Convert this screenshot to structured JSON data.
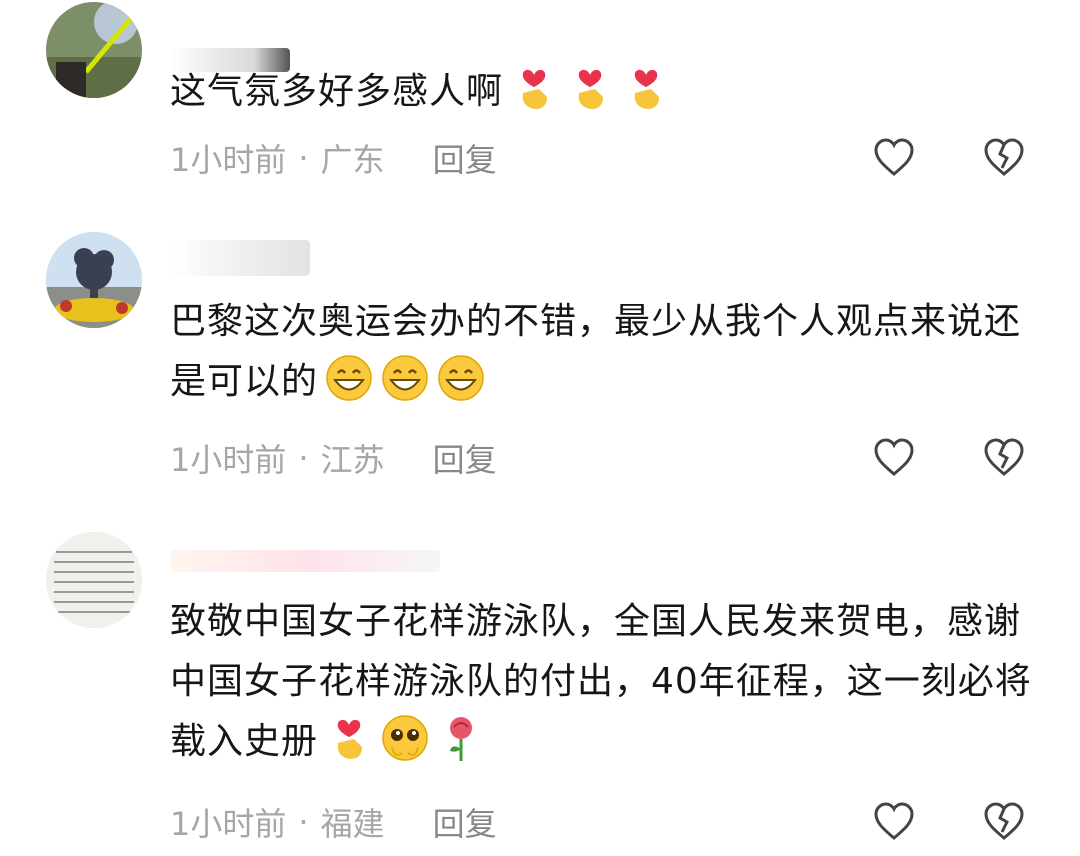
{
  "comments": [
    {
      "text": "这气氛多好多感人啊",
      "emoji": [
        "heart-hand",
        "heart-hand",
        "heart-hand"
      ],
      "time": "1小时前",
      "location": "广东",
      "reply": "回复"
    },
    {
      "text": "巴黎这次奥运会办的不错，最少从我个人观点来说还是可以的",
      "emoji": [
        "grin",
        "grin",
        "grin"
      ],
      "time": "1小时前",
      "location": "江苏",
      "reply": "回复"
    },
    {
      "text": "致敬中国女子花样游泳队，全国人民发来贺电，感谢中国女子花样游泳队的付出，40年征程，这一刻必将载入史册",
      "emoji": [
        "heart-hand",
        "pleading",
        "rose"
      ],
      "time": "1小时前",
      "location": "福建",
      "reply": "回复"
    }
  ],
  "colors": {
    "meta": "#a6a6a6",
    "reply": "#888888",
    "text": "#161616"
  },
  "separator": "·"
}
